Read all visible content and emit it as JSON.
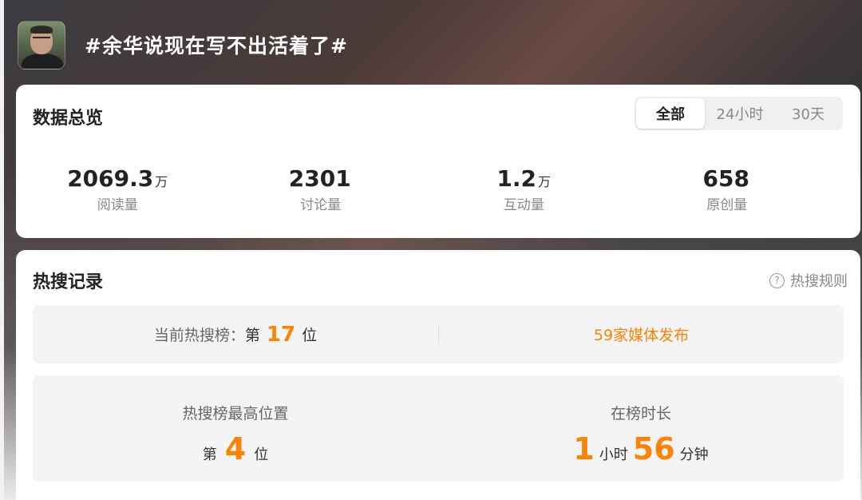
{
  "header": {
    "topic": "#余华说现在写不出活着了#"
  },
  "overview": {
    "title": "数据总览",
    "tabs": [
      "全部",
      "24小时",
      "30天"
    ],
    "active_tab": "全部",
    "stats": [
      {
        "value": "2069.3",
        "unit": "万",
        "label": "阅读量"
      },
      {
        "value": "2301",
        "unit": "",
        "label": "讨论量"
      },
      {
        "value": "1.2",
        "unit": "万",
        "label": "互动量"
      },
      {
        "value": "658",
        "unit": "",
        "label": "原创量"
      }
    ]
  },
  "hot_search": {
    "title": "热搜记录",
    "rules_label": "热搜规则",
    "current_rank_label": "当前热搜榜：",
    "rank_prefix": "第",
    "current_rank": "17",
    "rank_suffix": "位",
    "media_count_text": "59家媒体发布",
    "highest_label": "热搜榜最高位置",
    "highest_rank": "4",
    "duration_label": "在榜时长",
    "duration_hours": "1",
    "hours_unit": "小时",
    "duration_minutes": "56",
    "minutes_unit": "分钟"
  },
  "colors": {
    "accent": "#ff8200",
    "text_primary": "#222222",
    "text_secondary": "#888888",
    "panel_bg": "#f4f4f6"
  },
  "icons": {
    "help": "question-circle-icon"
  }
}
